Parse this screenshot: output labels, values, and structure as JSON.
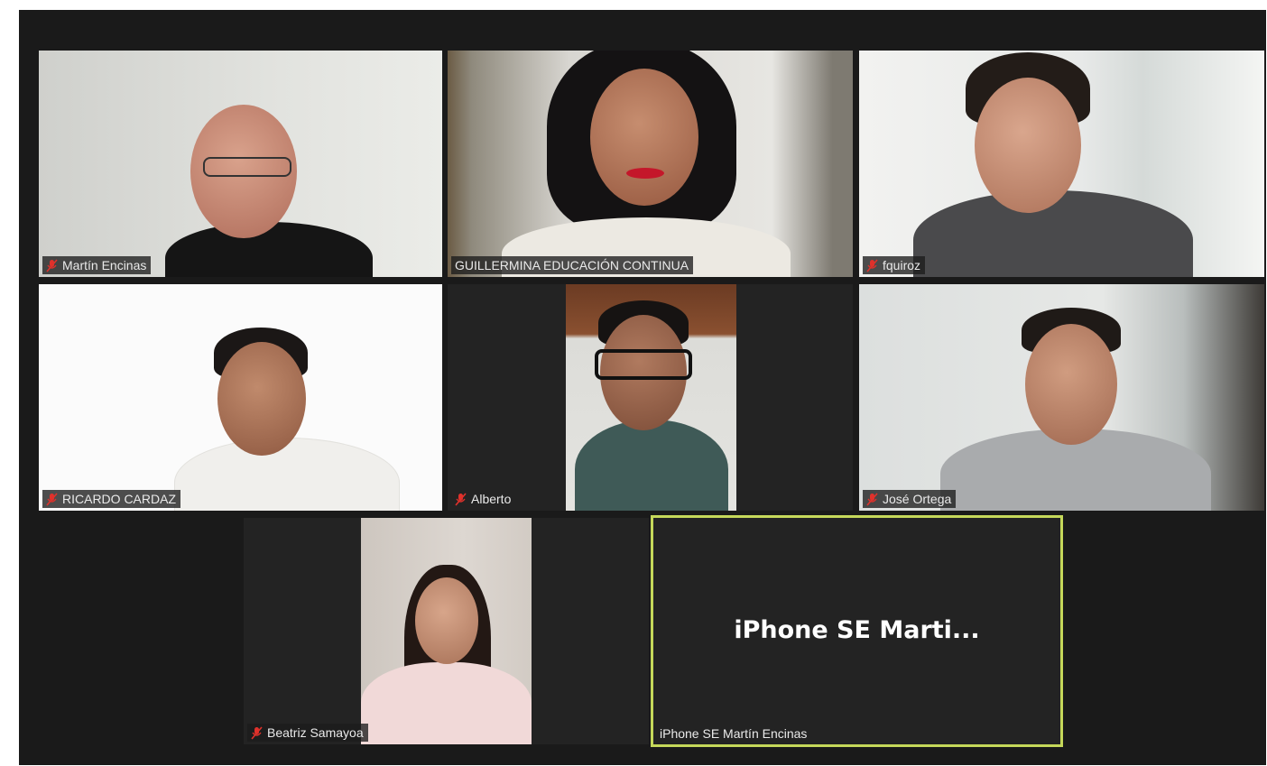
{
  "participants": [
    {
      "name": "Martín Encinas",
      "muted": true
    },
    {
      "name": "GUILLERMINA EDUCACIÓN CONTINUA",
      "muted": false
    },
    {
      "name": "fquiroz",
      "muted": true
    },
    {
      "name": "RICARDO CARDAZ",
      "muted": true
    },
    {
      "name": "Alberto",
      "muted": true
    },
    {
      "name": "José Ortega",
      "muted": true
    },
    {
      "name": "Beatriz Samayoa",
      "muted": true
    },
    {
      "name": "iPhone SE Martín Encinas",
      "muted": false,
      "video_off_title": "iPhone SE Marti...",
      "active_speaker": true
    }
  ],
  "colors": {
    "background": "#1a1a1a",
    "speaker_outline": "#c5d85a",
    "muted_icon": "#e0312b"
  }
}
